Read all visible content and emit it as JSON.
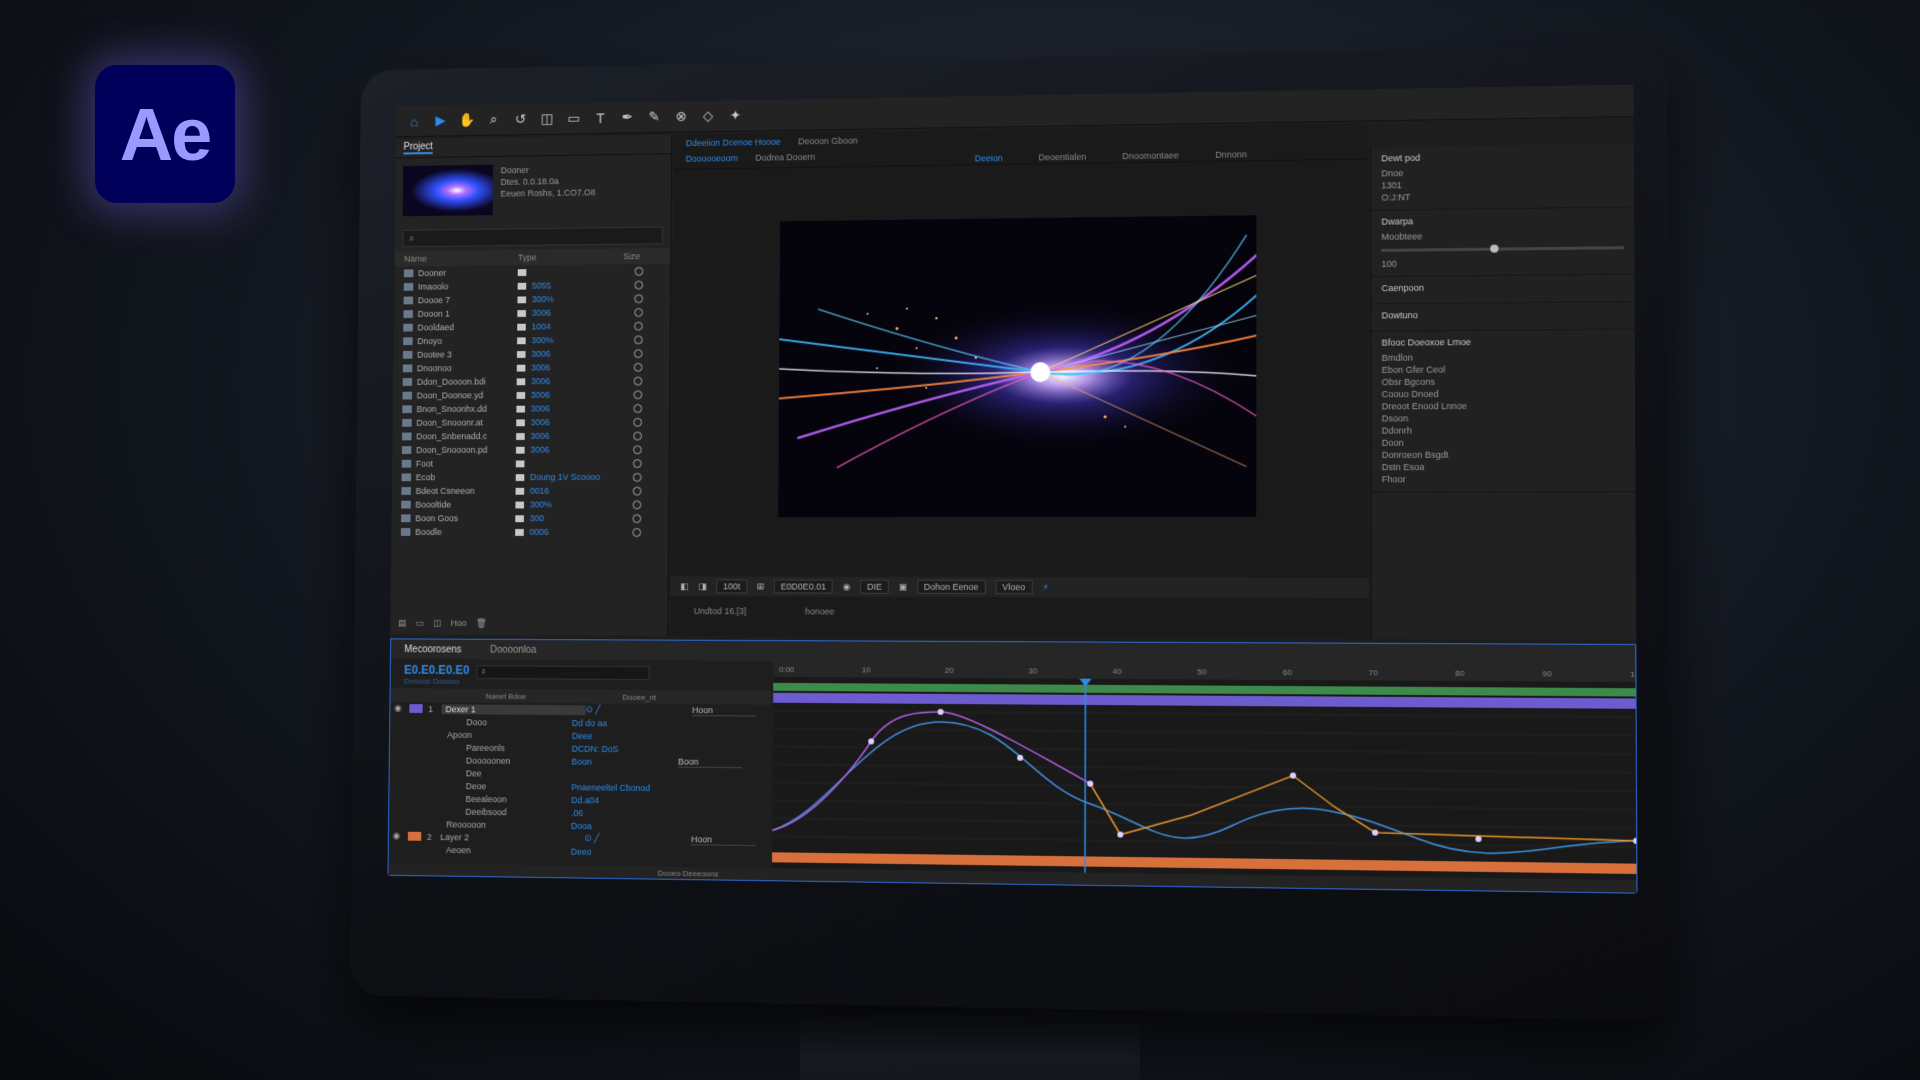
{
  "app": {
    "logo_text": "Ae",
    "colors": {
      "accent": "#2d8ceb",
      "logo_bg": "#00005b",
      "logo_fg": "#9999ff",
      "layer1": "#6d5bd0",
      "layer2": "#d8703c"
    }
  },
  "toolbar": {
    "tools": [
      "home-icon",
      "selection-tool-icon",
      "hand-tool-icon",
      "zoom-tool-icon",
      "rotate-tool-icon",
      "camera-tool-icon",
      "mask-tool-icon",
      "text-tool-icon",
      "pen-tool-icon",
      "brush-tool-icon",
      "clone-tool-icon",
      "eraser-tool-icon",
      "puppet-tool-icon"
    ]
  },
  "project": {
    "tab_label": "Project",
    "thumb_title": "Dooner",
    "thumb_line1": "Dtes. 0.0.18.0a",
    "thumb_line2": "Eeuen Roshs, 1.CO7.O8",
    "columns": [
      "Name",
      "Type",
      "Size"
    ],
    "items": [
      {
        "name": "Dooner",
        "val": ""
      },
      {
        "name": "Imaoolo",
        "val": "5055"
      },
      {
        "name": "Doooe 7",
        "val": "300%"
      },
      {
        "name": "Dooon 1",
        "val": "3006"
      },
      {
        "name": "Dooldaed",
        "val": "1004"
      },
      {
        "name": "Dnoyo",
        "val": "300%"
      },
      {
        "name": "Dootee 3",
        "val": "3006"
      },
      {
        "name": "Dnoonoo",
        "val": "3006"
      },
      {
        "name": "Ddon_Doooon.bdi",
        "val": "3006"
      },
      {
        "name": "Doon_Doonoe.yd",
        "val": "3006"
      },
      {
        "name": "Bnon_Snoonhx.dd",
        "val": "3006"
      },
      {
        "name": "Doon_Snooonr.at",
        "val": "3006"
      },
      {
        "name": "Doon_Snbenadd.c",
        "val": "3006"
      },
      {
        "name": "Doon_Snoooon.pd",
        "val": "3006"
      },
      {
        "name": "Foot",
        "val": ""
      },
      {
        "name": "Ecob",
        "val": "Doung 1V Scoooo"
      },
      {
        "name": "Bdeot Csneeon",
        "val": "0016"
      },
      {
        "name": "Boooltide",
        "val": "300%"
      },
      {
        "name": "Boon Goos",
        "val": "300"
      },
      {
        "name": "Boodle",
        "val": "0006"
      }
    ],
    "footer_label": "Hoo"
  },
  "viewer": {
    "tab1": "Ddeeiion Dcenoe Hoooe",
    "tab2": "Deooon Gboon",
    "sub1": "Doooooeoom",
    "sub2": "Dodrea Dooern",
    "zoom": "100t",
    "timecode": "E0D0E0.01",
    "res": "DIE",
    "camera": "Dohon Eenoe",
    "view": "Vloeo",
    "footer_left": "Undtod 16.[3]",
    "footer_mid": "honoee"
  },
  "workspaces": [
    "Deeion",
    "Deoentialen",
    "Dnoomontaee",
    "Dnnonn"
  ],
  "right_panel": {
    "title": "Dewt pod",
    "info_label": "Dnoe",
    "info_vals": [
      "1301",
      "O:J:NT"
    ],
    "section1": "Dwarpa",
    "slider_label": "Moobteee",
    "slider_val": "100",
    "section2": "Caenpoon",
    "section3": "Dowtuno",
    "section4": "Bfooc Doeoxoe Lrnoe",
    "section5": "Bmdlon",
    "effects": [
      "Ebon Gfer Ceol",
      "Obsr Bgcons",
      "Coouo Dnoed",
      "Dreoot Enood Lnnoe",
      "Dsoon",
      "Ddonrh",
      "Doon",
      "Donroeon Bsgdt",
      "Dstn Esoa",
      "Fhoor"
    ]
  },
  "timeline": {
    "tab_active": "Mecoorosens",
    "tab2": "Doooonloa",
    "timecode": "E0.E0.E0.E0",
    "timecode_sub": "Dooooo Dooooo",
    "search_placeholder": "",
    "head_cols": [
      "Nanet Bdoe",
      "Dooee_nt"
    ],
    "layers": [
      {
        "kind": "layer",
        "num": "1",
        "name": "Dexer 1",
        "val": "",
        "drop": "Hoon",
        "color": "#6d5bd0"
      },
      {
        "kind": "prop",
        "name": "Dooo",
        "val": "Dd do aa",
        "drop": ""
      },
      {
        "kind": "group",
        "name": "Apoon",
        "val": "Deee",
        "drop": ""
      },
      {
        "kind": "prop",
        "name": "Pareeonls",
        "val": "DCDN: DoS",
        "drop": ""
      },
      {
        "kind": "prop",
        "name": "Dooooonen",
        "val": "Boon",
        "drop": "Boon"
      },
      {
        "kind": "prop",
        "name": "Dee",
        "val": "",
        "drop": ""
      },
      {
        "kind": "prop",
        "name": "Deoe",
        "val": "Pnaeneeltel Cbonod",
        "drop": ""
      },
      {
        "kind": "prop",
        "name": "Beealeoon",
        "val": "Dd.a04",
        "drop": ""
      },
      {
        "kind": "prop",
        "name": "Deeibsood",
        "val": ".06",
        "drop": ""
      },
      {
        "kind": "group",
        "name": "Reooooon",
        "val": "Dooa",
        "drop": ""
      },
      {
        "kind": "layer",
        "num": "2",
        "name": "Layer 2",
        "val": "",
        "drop": "Hoon",
        "color": "#d8703c"
      },
      {
        "kind": "group",
        "name": "Aeoen",
        "val": "Deeo",
        "drop": ""
      }
    ],
    "ruler": [
      "0:00",
      "10",
      "20",
      "30",
      "40",
      "50",
      "60",
      "70",
      "80",
      "90",
      "100"
    ],
    "footer": "Dooeo Deeeoons"
  }
}
